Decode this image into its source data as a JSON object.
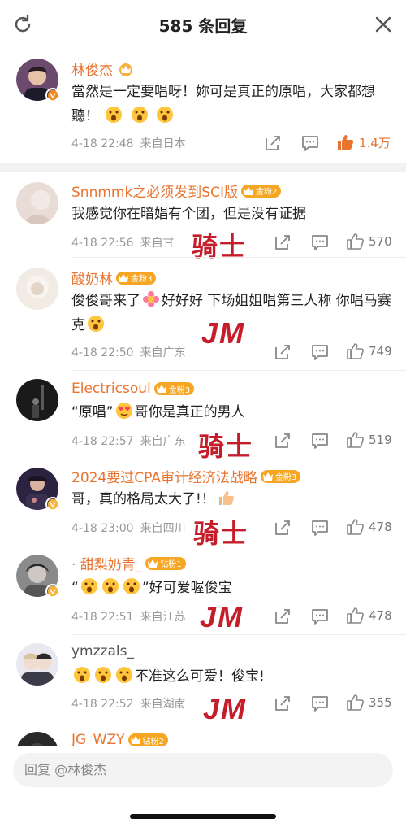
{
  "header": {
    "title": "585 条回复"
  },
  "main_comment": {
    "name": "林俊杰",
    "text_before": "當然是一定要唱呀！妳可是真正的原唱，大家都想聽！",
    "date": "4-18 22:48",
    "location": "来自日本",
    "likes": "1.4万"
  },
  "replies": [
    {
      "name": "Snnmmk之必须发到SCI版",
      "badge": "金粉2",
      "text": "我感觉你在暗娼有个团，但是没有证据",
      "date": "4-18 22:56",
      "location": "来自甘",
      "likes": "570",
      "stamp": "骑士"
    },
    {
      "name": "酸奶林",
      "badge": "金粉3",
      "text_a": "俊俊哥来了",
      "text_b": "好好好 下场姐姐唱第三人称 你唱马赛克",
      "date": "4-18 22:50",
      "location": "来自广东",
      "likes": "749",
      "stamp": "JM"
    },
    {
      "name": "Electricsoul",
      "badge": "金粉3",
      "text_a": "“原唱”",
      "text_b": "哥你是真正的男人",
      "date": "4-18 22:57",
      "location": "来自广东",
      "likes": "519",
      "stamp": "骑士"
    },
    {
      "name": "2024要过CPA审计经济法战略",
      "badge": "金粉3",
      "text": "哥，真的格局太大了!！",
      "date": "4-18 23:00",
      "location": "来自四川",
      "likes": "478",
      "stamp": "骑士"
    },
    {
      "name": "· 甜梨奶青_",
      "badge": "钻粉1",
      "text_a": "“",
      "text_b": "”好可爱喔俊宝",
      "date": "4-18 22:51",
      "location": "来自江苏",
      "likes": "478",
      "stamp": "JM"
    },
    {
      "name": "ymzzals_",
      "badge": "",
      "text": "不准这么可爱！俊宝!",
      "date": "4-18 22:52",
      "location": "来自湖南",
      "likes": "355",
      "stamp": "JM"
    },
    {
      "name": "JG_WZY",
      "badge": "钻粉2"
    }
  ],
  "input": {
    "placeholder": "回复 @林俊杰"
  },
  "icons": {
    "refresh": "refresh-icon",
    "close": "close-icon",
    "share": "share-icon",
    "comment": "comment-icon",
    "like": "thumbs-up-icon"
  },
  "colors": {
    "accent": "#e8742f",
    "stamp": "#c51d2a",
    "badge": "#f6a623"
  }
}
